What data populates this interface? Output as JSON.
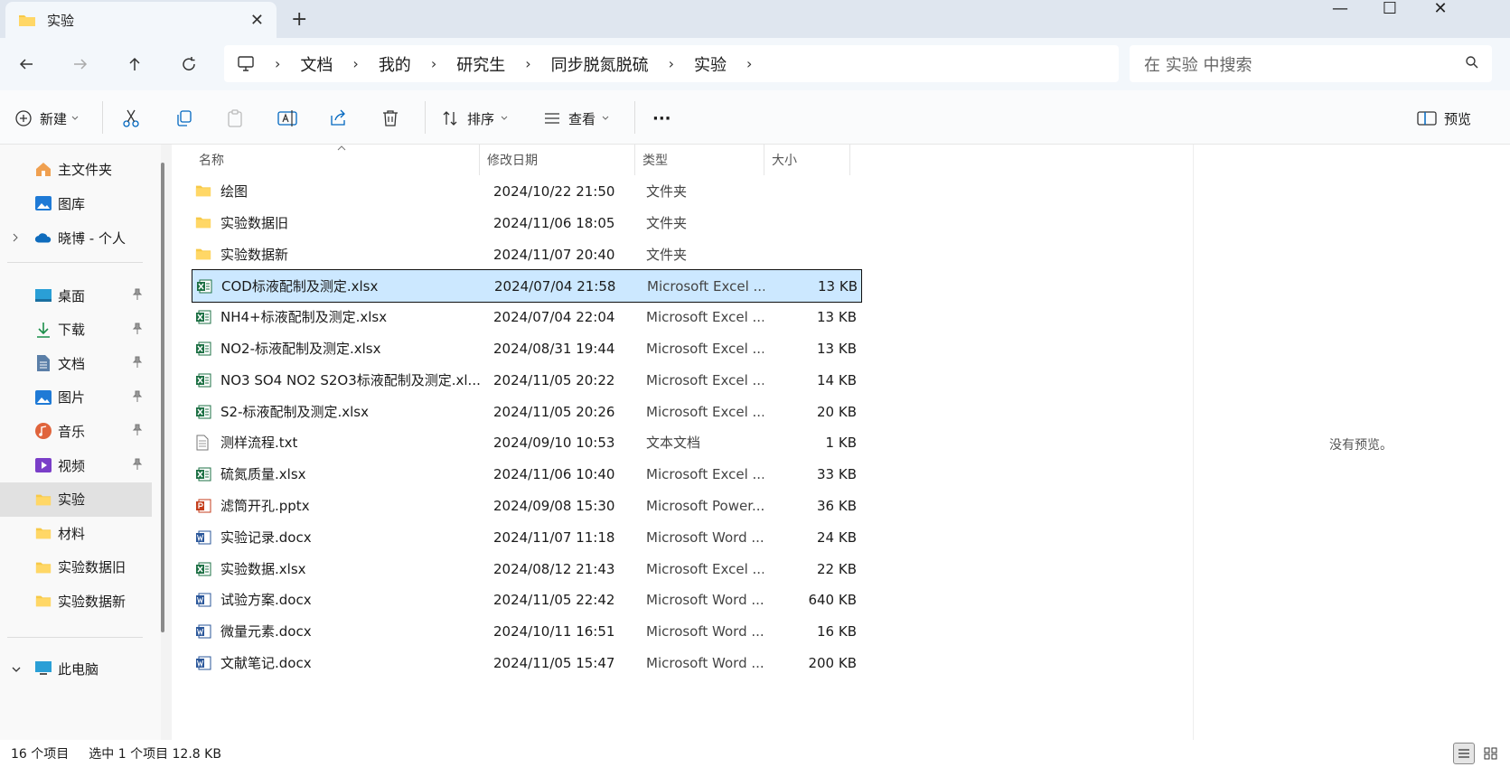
{
  "tab": {
    "title": "实验",
    "close": "✕",
    "new_tab": "+"
  },
  "window_controls": {
    "minimize": "—",
    "maximize": "☐",
    "close": "✕"
  },
  "breadcrumb": [
    "文档",
    "我的",
    "研究生",
    "同步脱氮脱硫",
    "实验"
  ],
  "breadcrumb_sep": "›",
  "search": {
    "placeholder": "在 实验 中搜索"
  },
  "toolbar": {
    "new_label": "新建",
    "sort_label": "排序",
    "view_label": "查看",
    "more_label": "···",
    "preview_label": "预览"
  },
  "sidebar": {
    "top": [
      {
        "label": "主文件夹",
        "icon": "home-icon"
      },
      {
        "label": "图库",
        "icon": "gallery-icon"
      },
      {
        "label": "晓博 - 个人",
        "icon": "cloud-icon"
      }
    ],
    "quick": [
      {
        "label": "桌面",
        "icon": "desktop-icon",
        "pinned": true
      },
      {
        "label": "下载",
        "icon": "download-icon",
        "pinned": true
      },
      {
        "label": "文档",
        "icon": "document-icon",
        "pinned": true
      },
      {
        "label": "图片",
        "icon": "pictures-icon",
        "pinned": true
      },
      {
        "label": "音乐",
        "icon": "music-icon",
        "pinned": true
      },
      {
        "label": "视频",
        "icon": "video-icon",
        "pinned": true
      },
      {
        "label": "实验",
        "icon": "folder-icon",
        "pinned": false,
        "selected": true
      },
      {
        "label": "材料",
        "icon": "folder-icon",
        "pinned": false
      },
      {
        "label": "实验数据旧",
        "icon": "folder-icon",
        "pinned": false
      },
      {
        "label": "实验数据新",
        "icon": "folder-icon",
        "pinned": false
      }
    ],
    "thispc": {
      "label": "此电脑",
      "icon": "computer-icon"
    }
  },
  "columns": {
    "name": "名称",
    "date": "修改日期",
    "type": "类型",
    "size": "大小"
  },
  "files": [
    {
      "name": "绘图",
      "date": "2024/10/22 21:50",
      "type": "文件夹",
      "size": "",
      "kind": "folder"
    },
    {
      "name": "实验数据旧",
      "date": "2024/11/06 18:05",
      "type": "文件夹",
      "size": "",
      "kind": "folder"
    },
    {
      "name": "实验数据新",
      "date": "2024/11/07 20:40",
      "type": "文件夹",
      "size": "",
      "kind": "folder"
    },
    {
      "name": "COD标液配制及测定.xlsx",
      "date": "2024/07/04 21:58",
      "type": "Microsoft Excel ...",
      "size": "13 KB",
      "kind": "excel",
      "selected": true
    },
    {
      "name": "NH4+标液配制及测定.xlsx",
      "date": "2024/07/04 22:04",
      "type": "Microsoft Excel ...",
      "size": "13 KB",
      "kind": "excel"
    },
    {
      "name": "NO2-标液配制及测定.xlsx",
      "date": "2024/08/31 19:44",
      "type": "Microsoft Excel ...",
      "size": "13 KB",
      "kind": "excel"
    },
    {
      "name": "NO3 SO4 NO2 S2O3标液配制及测定.xl...",
      "date": "2024/11/05 20:22",
      "type": "Microsoft Excel ...",
      "size": "14 KB",
      "kind": "excel"
    },
    {
      "name": "S2-标液配制及测定.xlsx",
      "date": "2024/11/05 20:26",
      "type": "Microsoft Excel ...",
      "size": "20 KB",
      "kind": "excel"
    },
    {
      "name": "测样流程.txt",
      "date": "2024/09/10 10:53",
      "type": "文本文档",
      "size": "1 KB",
      "kind": "text"
    },
    {
      "name": "硫氮质量.xlsx",
      "date": "2024/11/06 10:40",
      "type": "Microsoft Excel ...",
      "size": "33 KB",
      "kind": "excel"
    },
    {
      "name": "滤筒开孔.pptx",
      "date": "2024/09/08 15:30",
      "type": "Microsoft Power...",
      "size": "36 KB",
      "kind": "ppt"
    },
    {
      "name": "实验记录.docx",
      "date": "2024/11/07 11:18",
      "type": "Microsoft Word ...",
      "size": "24 KB",
      "kind": "word"
    },
    {
      "name": "实验数据.xlsx",
      "date": "2024/08/12 21:43",
      "type": "Microsoft Excel ...",
      "size": "22 KB",
      "kind": "excel"
    },
    {
      "name": "试验方案.docx",
      "date": "2024/11/05 22:42",
      "type": "Microsoft Word ...",
      "size": "640 KB",
      "kind": "word"
    },
    {
      "name": "微量元素.docx",
      "date": "2024/10/11 16:51",
      "type": "Microsoft Word ...",
      "size": "16 KB",
      "kind": "word"
    },
    {
      "name": "文献笔记.docx",
      "date": "2024/11/05 15:47",
      "type": "Microsoft Word ...",
      "size": "200 KB",
      "kind": "word"
    }
  ],
  "preview": {
    "message": "没有预览。"
  },
  "status": {
    "count": "16 个项目",
    "selection": "选中 1 个项目  12.8 KB"
  },
  "colors": {
    "accent": "#0067c0",
    "selected_row": "#cce8ff",
    "folder": "#f7c948",
    "excel": "#1d7044",
    "word": "#2b579a",
    "ppt": "#c43e1c"
  }
}
